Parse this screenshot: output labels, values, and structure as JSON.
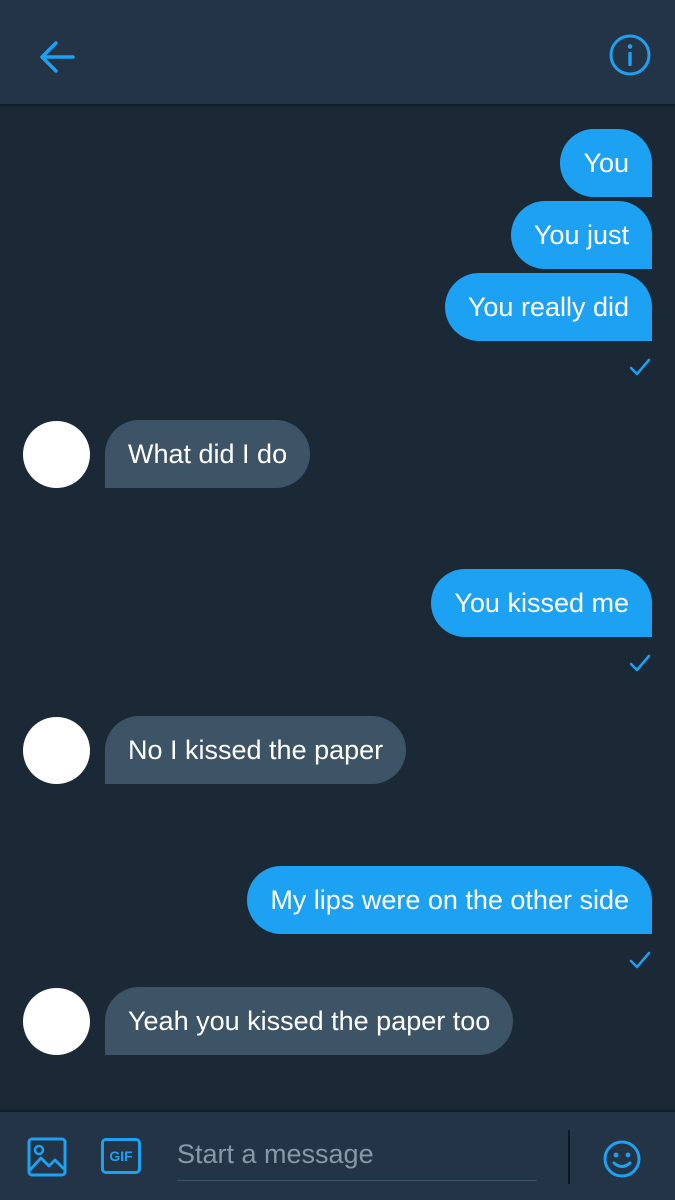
{
  "header": {
    "back_icon": "arrow-left-icon",
    "info_icon": "info-circle-icon"
  },
  "colors": {
    "accent": "#1da1f2",
    "background": "#1b2836",
    "header_bg": "#243447",
    "incoming_bubble": "#3d5466",
    "avatar": "#ffffff"
  },
  "messages": [
    {
      "direction": "outgoing",
      "text": "You"
    },
    {
      "direction": "outgoing",
      "text": "You just"
    },
    {
      "direction": "outgoing",
      "text": "You really did",
      "status": "sent-check-icon"
    },
    {
      "direction": "incoming",
      "text": "What did I do"
    },
    {
      "direction": "outgoing",
      "text": "You kissed me",
      "status": "sent-check-icon"
    },
    {
      "direction": "incoming",
      "text": "No I kissed the paper"
    },
    {
      "direction": "outgoing",
      "text": "My lips were on the other side",
      "status": "sent-check-icon"
    },
    {
      "direction": "incoming",
      "text": "Yeah you kissed the paper too"
    }
  ],
  "composer": {
    "image_icon": "image-icon",
    "gif_label": "GIF",
    "placeholder": "Start a message",
    "value": "",
    "emoji_icon": "smiley-icon"
  }
}
